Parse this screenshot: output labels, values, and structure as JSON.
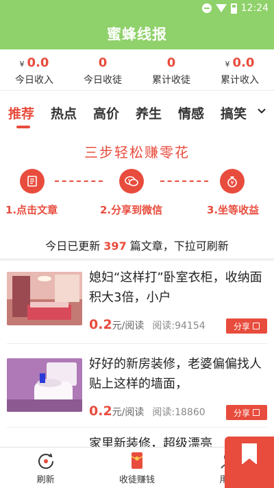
{
  "status_bar": {
    "time": "12:24"
  },
  "app_title": "蜜蜂线报",
  "stats": [
    {
      "currency": "¥",
      "value": "0.0",
      "label": "今日收入"
    },
    {
      "currency": "",
      "value": "0",
      "label": "今日收徒"
    },
    {
      "currency": "",
      "value": "0",
      "label": "累计收徒"
    },
    {
      "currency": "¥",
      "value": "0.0",
      "label": "累计收入"
    }
  ],
  "tabs": [
    "推荐",
    "热点",
    "高价",
    "养生",
    "情感",
    "搞笑"
  ],
  "promo": {
    "title": "三步轻松赚零花",
    "steps": [
      "1.点击文章",
      "2.分享到微信",
      "3.坐等收益"
    ]
  },
  "update": {
    "prefix": "今日已更新 ",
    "count": "397",
    "suffix": " 篇文章，下拉可刷新"
  },
  "articles": [
    {
      "title": "媳妇“这样打”卧室衣柜，收纳面积大3倍，小户",
      "price": "0.2",
      "unit": "元/阅读",
      "reads_label": "阅读:94154",
      "share_label": "分享"
    },
    {
      "title": "好好的新房装修，老婆偏偏找人贴上这样的墙面，",
      "price": "0.2",
      "unit": "元/阅读",
      "reads_label": "阅读:18860",
      "share_label": "分享"
    },
    {
      "title": "家里新装修，超级漂亮",
      "price": "",
      "unit": "",
      "reads_label": "",
      "share_label": ""
    }
  ],
  "bottom_nav": [
    {
      "label": "刷新",
      "icon": "refresh-icon"
    },
    {
      "label": "收徒赚钱",
      "icon": "red-envelope-icon"
    },
    {
      "label": "用户",
      "icon": "user-icon"
    }
  ],
  "colors": {
    "brand_green": "#8fd16a",
    "accent_red": "#e84c3d"
  }
}
